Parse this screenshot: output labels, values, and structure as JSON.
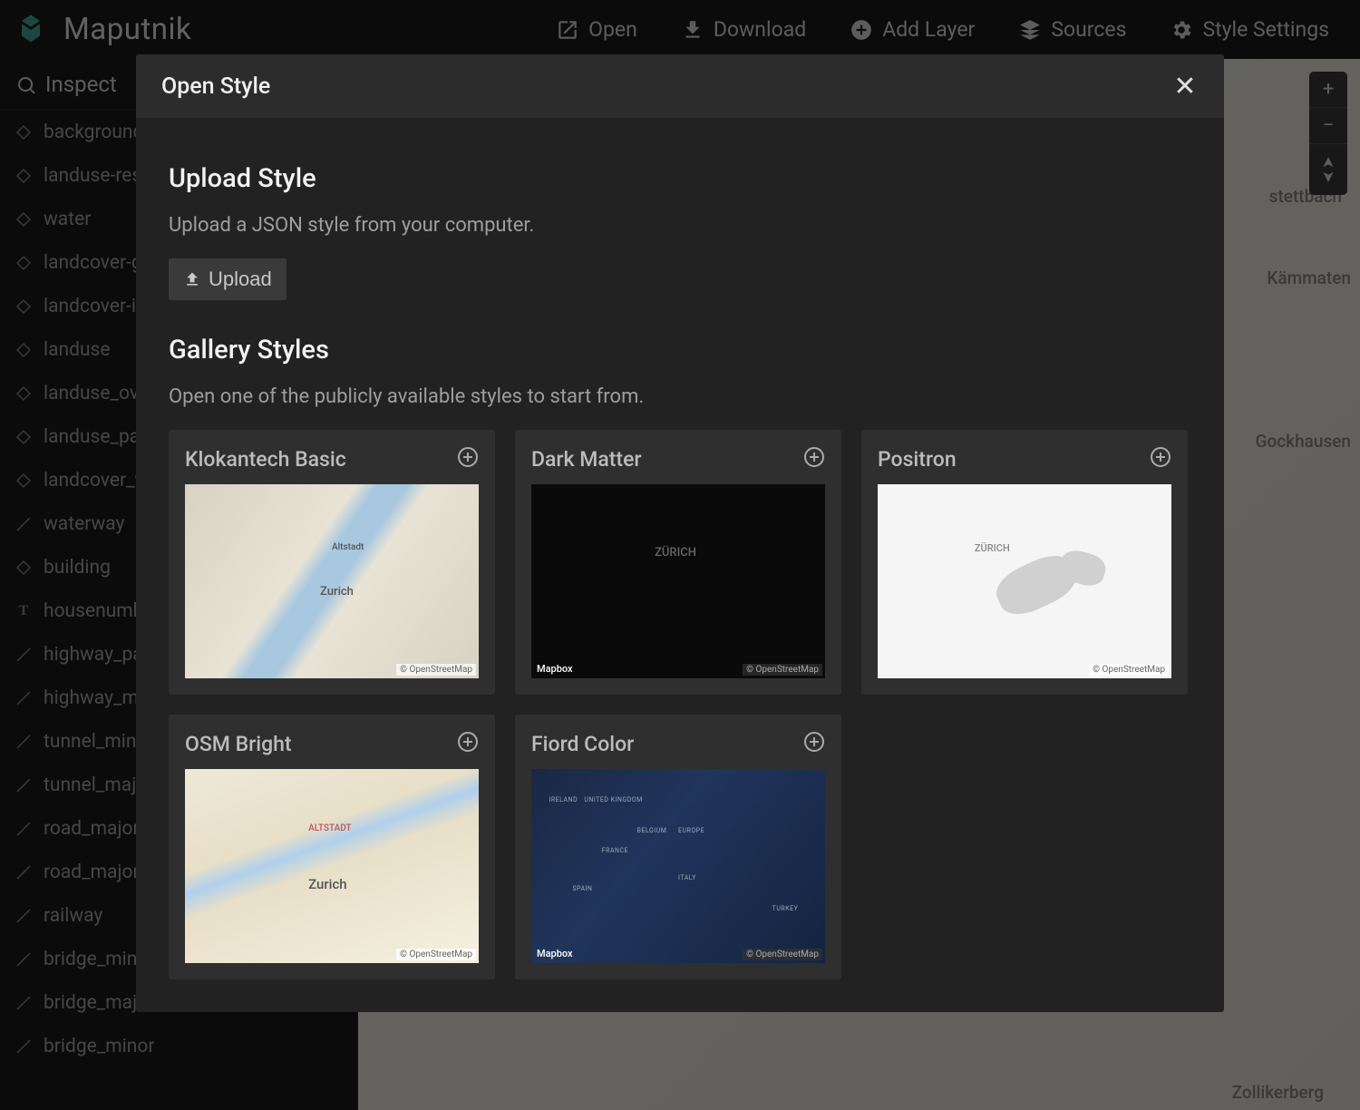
{
  "app": {
    "title": "Maputnik"
  },
  "toolbar": {
    "open": "Open",
    "download": "Download",
    "add_layer": "Add Layer",
    "sources": "Sources",
    "style_settings": "Style Settings"
  },
  "sidebar": {
    "inspect": "Inspect",
    "layers": [
      {
        "name": "background",
        "type": "background"
      },
      {
        "name": "landuse-residential",
        "type": "fill"
      },
      {
        "name": "water",
        "type": "fill"
      },
      {
        "name": "landcover-glacier",
        "type": "fill"
      },
      {
        "name": "landcover-ice-shelf",
        "type": "fill"
      },
      {
        "name": "landuse",
        "type": "fill"
      },
      {
        "name": "landuse_overlay",
        "type": "fill"
      },
      {
        "name": "landuse_park",
        "type": "fill"
      },
      {
        "name": "landcover_wood",
        "type": "fill"
      },
      {
        "name": "waterway",
        "type": "line"
      },
      {
        "name": "building",
        "type": "fill"
      },
      {
        "name": "housenumber",
        "type": "symbol"
      },
      {
        "name": "highway_path",
        "type": "line"
      },
      {
        "name": "highway_minor",
        "type": "line"
      },
      {
        "name": "tunnel_minor",
        "type": "line"
      },
      {
        "name": "tunnel_major",
        "type": "line"
      },
      {
        "name": "road_major_casing",
        "type": "line"
      },
      {
        "name": "road_major",
        "type": "line"
      },
      {
        "name": "railway",
        "type": "line"
      },
      {
        "name": "bridge_minor case",
        "type": "line"
      },
      {
        "name": "bridge_major case",
        "type": "line"
      },
      {
        "name": "bridge_minor",
        "type": "line"
      }
    ]
  },
  "map": {
    "labels": [
      "stettbach",
      "Kämmaten",
      "Gockhausen",
      "Zollikerberg"
    ]
  },
  "modal": {
    "title": "Open Style",
    "upload": {
      "heading": "Upload Style",
      "desc": "Upload a JSON style from your computer.",
      "button": "Upload"
    },
    "gallery": {
      "heading": "Gallery Styles",
      "desc": "Open one of the publicly available styles to start from.",
      "items": [
        {
          "title": "Klokantech Basic",
          "thumb": "basic"
        },
        {
          "title": "Dark Matter",
          "thumb": "dark"
        },
        {
          "title": "Positron",
          "thumb": "positron"
        },
        {
          "title": "OSM Bright",
          "thumb": "osm"
        },
        {
          "title": "Fiord Color",
          "thumb": "fiord"
        }
      ]
    },
    "attribution": "© OpenStreetMap",
    "mapbox_logo": "Mapbox"
  }
}
